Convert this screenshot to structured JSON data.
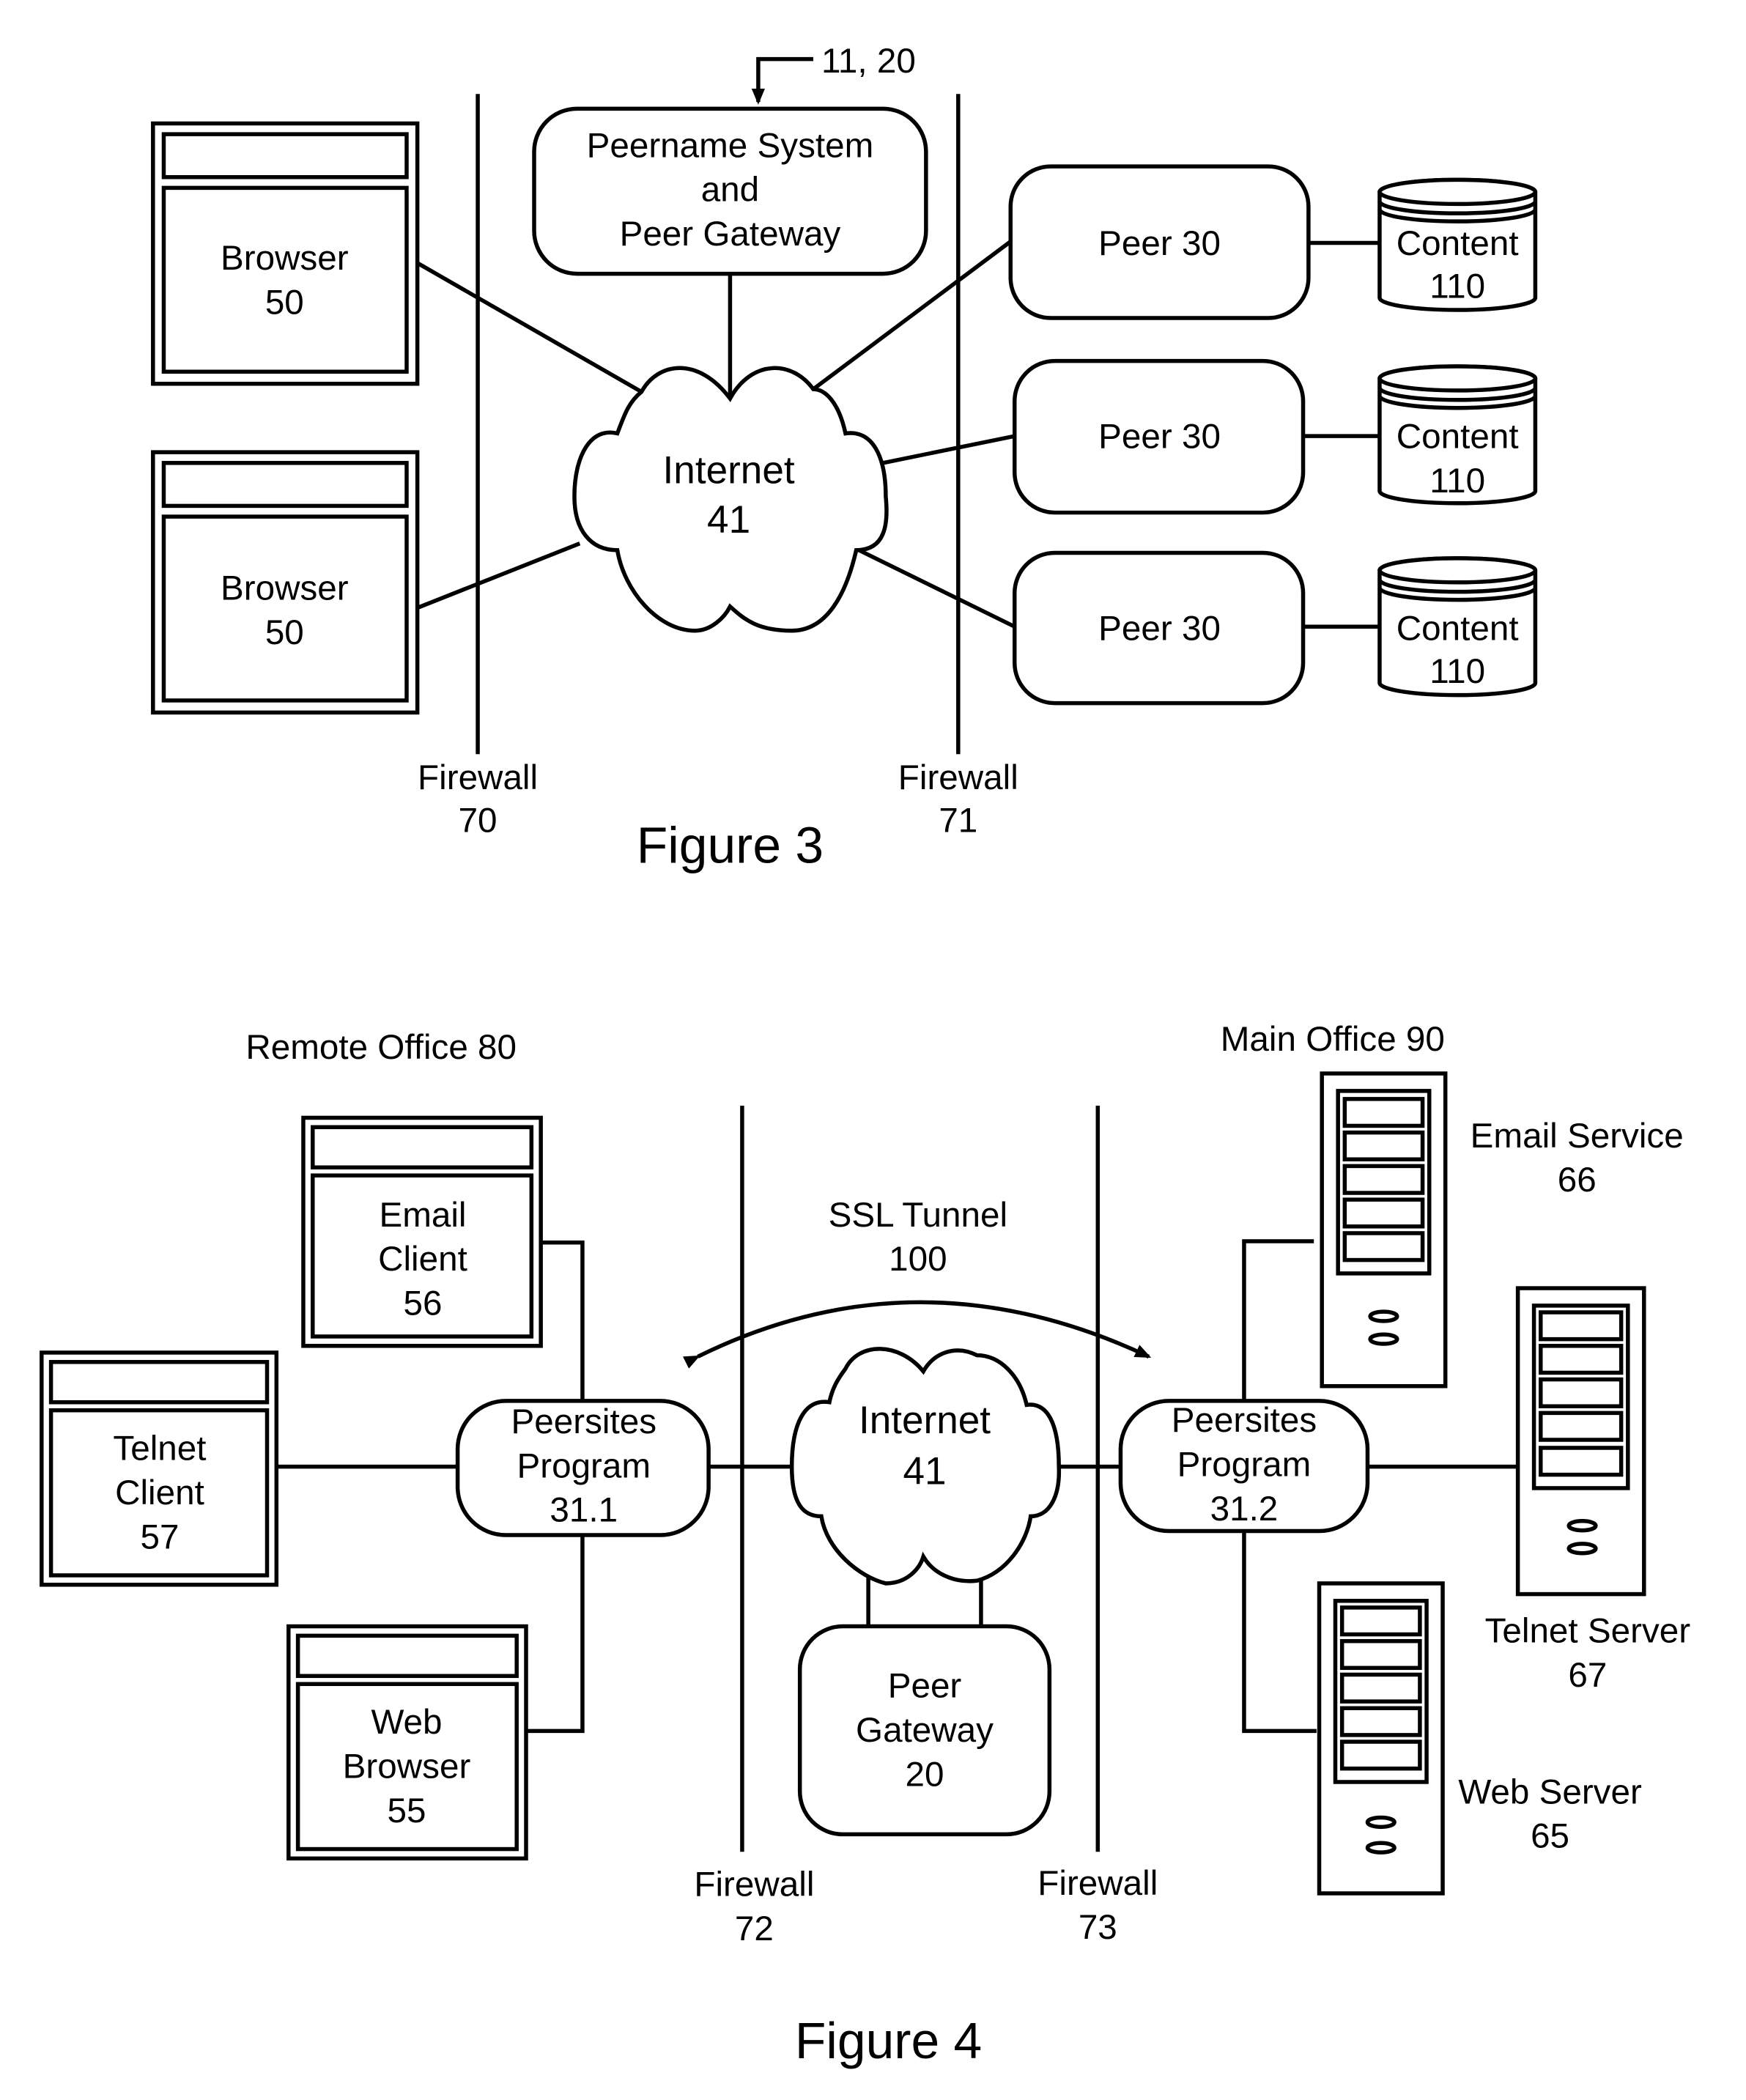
{
  "figure3": {
    "caption": "Figure 3",
    "reference_arrow_label": "11, 20",
    "peername_system": {
      "lines": [
        "Peername System",
        "and",
        "Peer Gateway"
      ]
    },
    "internet": {
      "lines": [
        "Internet",
        "41"
      ]
    },
    "browsers": [
      {
        "lines": [
          "Browser",
          "50"
        ]
      },
      {
        "lines": [
          "Browser",
          "50"
        ]
      }
    ],
    "peers": [
      {
        "label": "Peer 30",
        "content": [
          "Content",
          "110"
        ]
      },
      {
        "label": "Peer 30",
        "content": [
          "Content",
          "110"
        ]
      },
      {
        "label": "Peer 30",
        "content": [
          "Content",
          "110"
        ]
      }
    ],
    "firewalls": [
      {
        "lines": [
          "Firewall",
          "70"
        ]
      },
      {
        "lines": [
          "Firewall",
          "71"
        ]
      }
    ]
  },
  "figure4": {
    "caption": "Figure 4",
    "remote_office": "Remote Office 80",
    "main_office": "Main Office 90",
    "ssl_tunnel": {
      "lines": [
        "SSL Tunnel",
        "100"
      ]
    },
    "internet": {
      "lines": [
        "Internet",
        "41"
      ]
    },
    "peer_gateway": {
      "lines": [
        "Peer",
        "Gateway",
        "20"
      ]
    },
    "clients": {
      "email": {
        "lines": [
          "Email",
          "Client",
          "56"
        ]
      },
      "telnet": {
        "lines": [
          "Telnet",
          "Client",
          "57"
        ]
      },
      "web": {
        "lines": [
          "Web",
          "Browser",
          "55"
        ]
      }
    },
    "peersites": [
      {
        "lines": [
          "Peersites",
          "Program",
          "31.1"
        ]
      },
      {
        "lines": [
          "Peersites",
          "Program",
          "31.2"
        ]
      }
    ],
    "servers": {
      "email": {
        "lines": [
          "Email Service",
          "66"
        ]
      },
      "telnet": {
        "lines": [
          "Telnet Server",
          "67"
        ]
      },
      "web": {
        "lines": [
          "Web Server",
          "65"
        ]
      }
    },
    "firewalls": [
      {
        "lines": [
          "Firewall",
          "72"
        ]
      },
      {
        "lines": [
          "Firewall",
          "73"
        ]
      }
    ]
  }
}
